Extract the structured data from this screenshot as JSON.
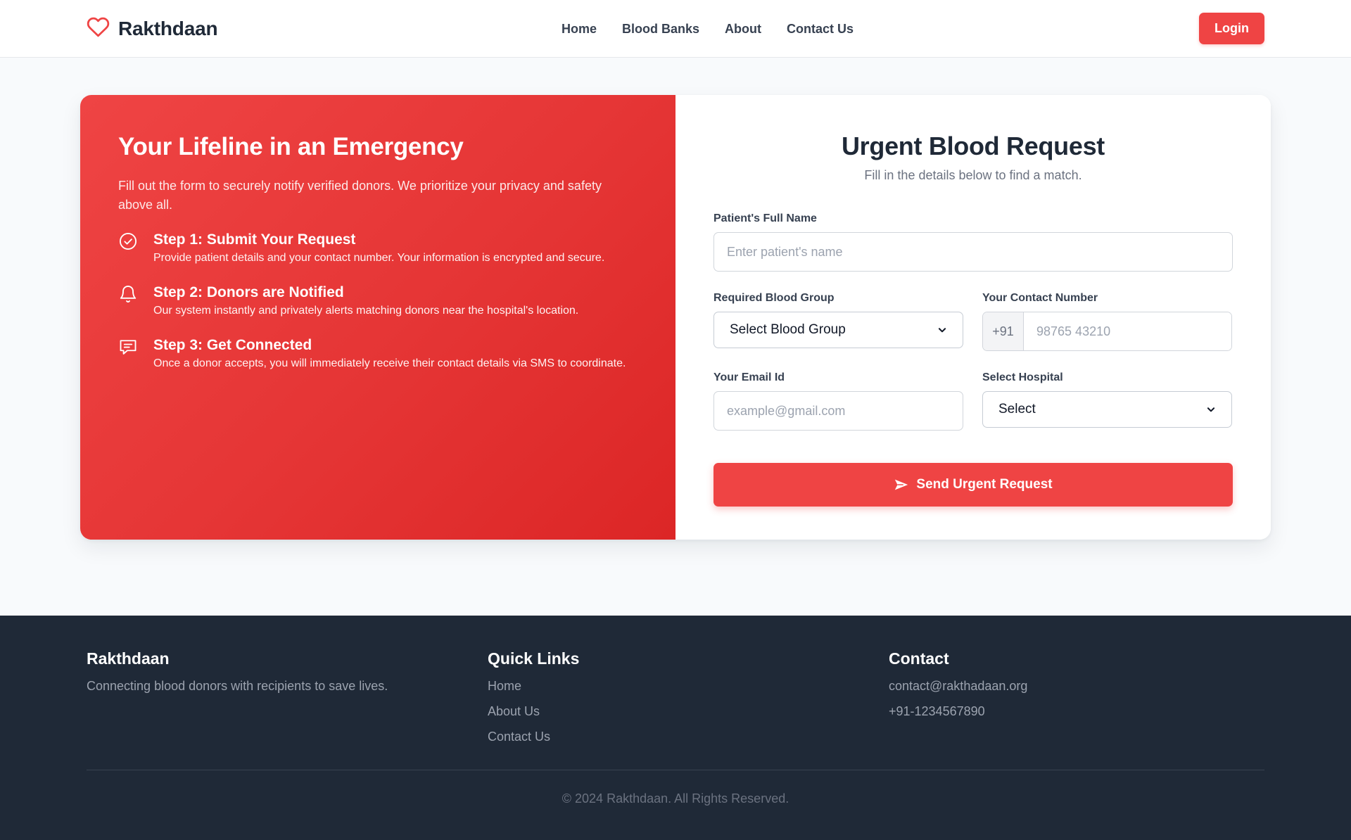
{
  "nav": {
    "brand": "Rakthdaan",
    "links": [
      "Home",
      "Blood Banks",
      "About",
      "Contact Us"
    ],
    "login_label": "Login"
  },
  "info": {
    "title": "Your Lifeline in an Emergency",
    "text": "Fill out the form to securely notify verified donors. We prioritize your privacy and safety above all.",
    "steps": [
      {
        "icon": "check-circle-icon",
        "title": "Step 1: Submit Your Request",
        "desc": "Provide patient details and your contact number. Your information is encrypted and secure."
      },
      {
        "icon": "bell-icon",
        "title": "Step 2: Donors are Notified",
        "desc": "Our system instantly and privately alerts matching donors near the hospital's location."
      },
      {
        "icon": "chat-icon",
        "title": "Step 3: Get Connected",
        "desc": "Once a donor accepts, you will immediately receive their contact details via SMS to coordinate."
      }
    ]
  },
  "form": {
    "title": "Urgent Blood Request",
    "subtitle": "Fill in the details below to find a match.",
    "patient_label": "Patient's Full Name",
    "patient_placeholder": "Enter patient's name",
    "blood_group_label": "Required Blood Group",
    "blood_group_value": "Select Blood Group",
    "contact_label": "Your Contact Number",
    "contact_prefix": "+91",
    "contact_placeholder": "98765 43210",
    "email_label": "Your Email Id",
    "email_placeholder": "example@gmail.com",
    "hospital_label": "Select Hospital",
    "hospital_value": "Select",
    "submit_label": "Send Urgent Request"
  },
  "footer": {
    "brand": "Rakthdaan",
    "tagline": "Connecting blood donors with recipients to save lives.",
    "quick_links_heading": "Quick Links",
    "quick_links": [
      "Home",
      "About Us",
      "Contact Us"
    ],
    "contact_heading": "Contact",
    "email": "contact@rakthadaan.org",
    "phone": "+91-1234567890",
    "copyright": "© 2024 Rakthdaan. All Rights Reserved."
  },
  "colors": {
    "accent": "#ef4444",
    "footer_bg": "#1f2937",
    "page_bg": "#f8fafc"
  }
}
